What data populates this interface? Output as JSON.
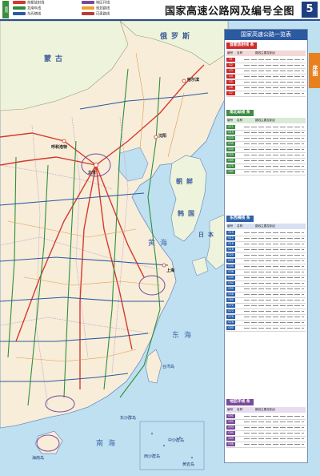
{
  "header": {
    "legend_tag": "图例",
    "legend": [
      {
        "text": "首都放射线",
        "color": "#d43a2e"
      },
      {
        "text": "北南纵线",
        "color": "#2f8f3c"
      },
      {
        "text": "东西横线",
        "color": "#2c5aa0"
      },
      {
        "text": "地区环线",
        "color": "#7a4a9a"
      },
      {
        "text": "规划路线",
        "color": "#f0a030"
      },
      {
        "text": "已建路线",
        "color": "#b83d3d"
      }
    ],
    "title": "国家高速公路网及编号全图",
    "page_number": "5"
  },
  "side_tab": "序图",
  "map": {
    "land_color": "#f7edd9",
    "sea_color": "#bfe0f0",
    "foreign_color": "#eef3dc",
    "labels": {
      "mongolia": "蒙古",
      "russia": "俄罗斯",
      "korea_n": "朝鲜",
      "korea_s": "韩国",
      "yellow_sea": "黄海",
      "east_sea": "东海",
      "south_sea": "南海",
      "japan": "日本",
      "taiwan": "台湾岛",
      "hainan": "海南岛",
      "beijing": "北京",
      "shanghai": "上海",
      "harbin": "哈尔滨",
      "shenyang": "沈阳",
      "hohhot": "呼和浩特",
      "dongsha": "东沙群岛",
      "zhongsha": "中沙群岛",
      "xisha": "西沙群岛",
      "huangyan": "黄岩岛"
    }
  },
  "panel": {
    "title": "国家高速公路一览表",
    "col_code": "编号",
    "col_name": "名称",
    "col_route": "路线主要控制点",
    "sections": [
      {
        "name": "首都放射线 条",
        "rows": [
          "G1",
          "G2",
          "G3",
          "G4",
          "G5",
          "G6",
          "G7"
        ]
      },
      {
        "name": "南北纵线 条",
        "rows": [
          "G11",
          "G15",
          "G25",
          "G35",
          "G45",
          "G55",
          "G65",
          "G75",
          "G85"
        ]
      },
      {
        "name": "东西横线 条",
        "rows": [
          "G10",
          "G12",
          "G16",
          "G18",
          "G20",
          "G22",
          "G30",
          "G36",
          "G40",
          "G42",
          "G50",
          "G56",
          "G60",
          "G70",
          "G72",
          "G76",
          "G78",
          "G80"
        ]
      },
      {
        "name": "地区环线 条",
        "rows": [
          "G91",
          "G92",
          "G93",
          "G94",
          "G95",
          "G98"
        ]
      }
    ]
  }
}
